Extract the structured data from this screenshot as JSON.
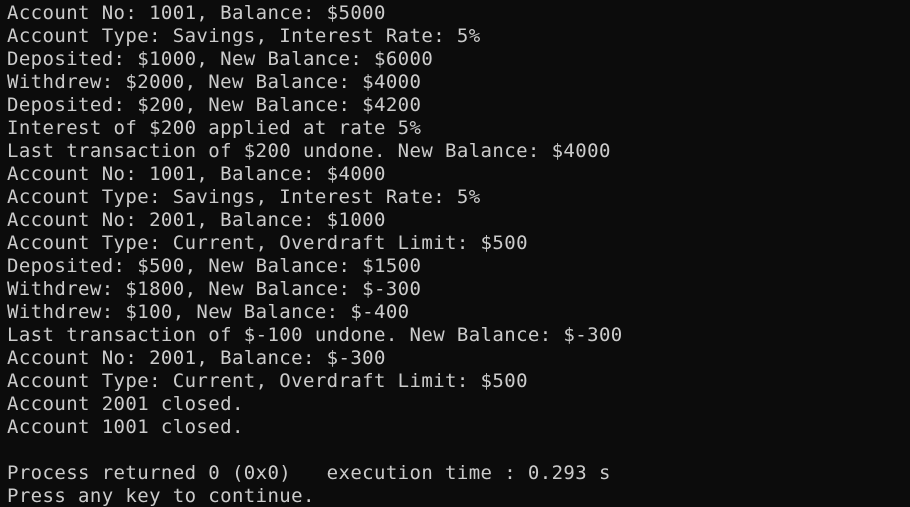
{
  "console": {
    "colors": {
      "background": "#0c0c0c",
      "text": "#cccccc"
    },
    "lines": [
      "Account No: 1001, Balance: $5000",
      "Account Type: Savings, Interest Rate: 5%",
      "Deposited: $1000, New Balance: $6000",
      "Withdrew: $2000, New Balance: $4000",
      "Deposited: $200, New Balance: $4200",
      "Interest of $200 applied at rate 5%",
      "Last transaction of $200 undone. New Balance: $4000",
      "Account No: 1001, Balance: $4000",
      "Account Type: Savings, Interest Rate: 5%",
      "Account No: 2001, Balance: $1000",
      "Account Type: Current, Overdraft Limit: $500",
      "Deposited: $500, New Balance: $1500",
      "Withdrew: $1800, New Balance: $-300",
      "Withdrew: $100, New Balance: $-400",
      "Last transaction of $-100 undone. New Balance: $-300",
      "Account No: 2001, Balance: $-300",
      "Account Type: Current, Overdraft Limit: $500",
      "Account 2001 closed.",
      "Account 1001 closed."
    ],
    "process_returned": "Process returned 0 (0x0)   execution time : 0.293 s",
    "press_key": "Press any key to continue."
  }
}
